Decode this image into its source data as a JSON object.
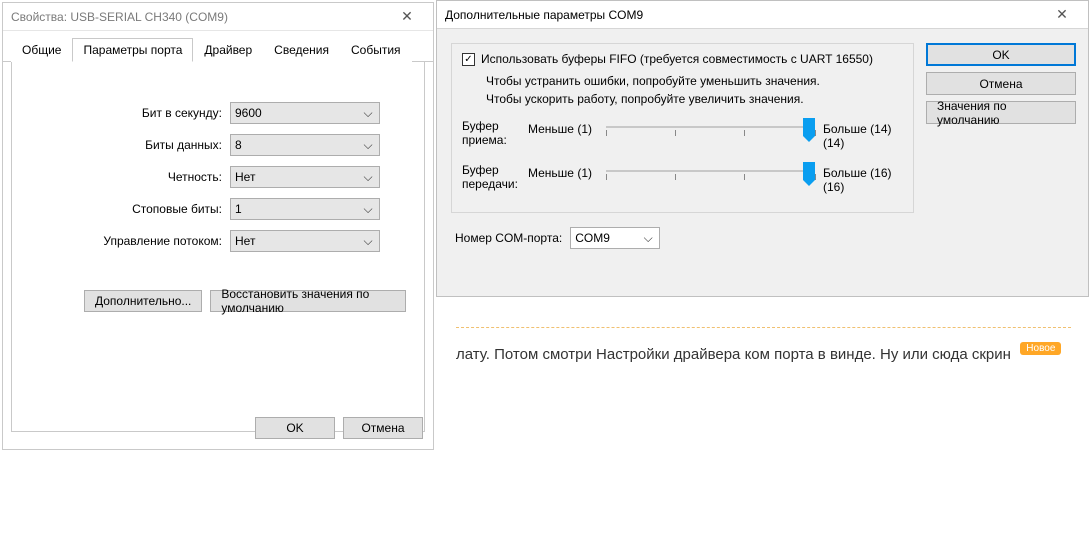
{
  "props": {
    "title": "Свойства: USB-SERIAL CH340 (COM9)",
    "tabs": [
      "Общие",
      "Параметры порта",
      "Драйвер",
      "Сведения",
      "События"
    ],
    "active_tab": 1,
    "fields": {
      "baud": {
        "label": "Бит в секунду:",
        "value": "9600"
      },
      "data": {
        "label": "Биты данных:",
        "value": "8"
      },
      "parity": {
        "label": "Четность:",
        "value": "Нет"
      },
      "stop": {
        "label": "Стоповые биты:",
        "value": "1"
      },
      "flow": {
        "label": "Управление потоком:",
        "value": "Нет"
      }
    },
    "advanced_btn": "Дополнительно...",
    "restore_btn": "Восстановить значения по умолчанию",
    "ok": "OK",
    "cancel": "Отмена"
  },
  "adv": {
    "title": "Дополнительные параметры COM9",
    "use_fifo": "Использовать буферы FIFO (требуется совместимость с UART 16550)",
    "hint1": "Чтобы устранить ошибки, попробуйте уменьшить значения.",
    "hint2": "Чтобы ускорить работу, попробуйте увеличить значения.",
    "rx": {
      "label": "Буфер приема:",
      "min": "Меньше (1)",
      "max": "Больше (14)",
      "val": "(14)"
    },
    "tx": {
      "label": "Буфер передачи:",
      "min": "Меньше (1)",
      "max": "Больше (16)",
      "val": "(16)"
    },
    "port_label": "Номер COM-порта:",
    "port_value": "COM9",
    "ok": "OK",
    "cancel": "Отмена",
    "defaults": "Значения по умолчанию"
  },
  "page": {
    "text": "лату. Потом смотри Настройки драйвера ком порта в винде. Ну или сюда скрин",
    "badge": "Новое"
  }
}
